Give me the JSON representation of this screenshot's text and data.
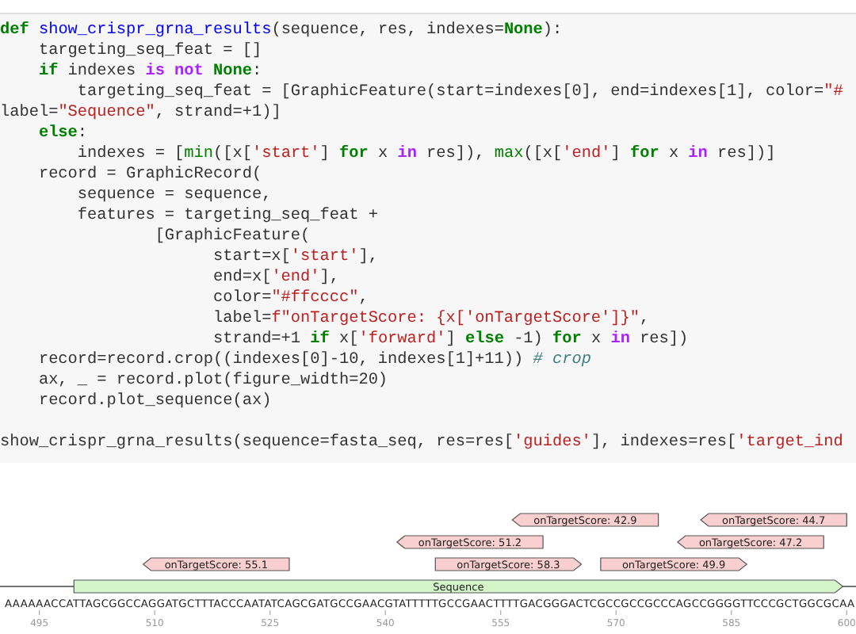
{
  "code_cell": {
    "blocks": [
      {
        "lines": [
          [
            {
              "text": "def ",
              "kind": "keyword"
            },
            {
              "text": "show_crispr_grna_results",
              "kind": "function"
            },
            {
              "text": "(sequence, res, indexes=",
              "kind": "plain"
            },
            {
              "text": "None",
              "kind": "keyword"
            },
            {
              "text": "):",
              "kind": "plain"
            }
          ],
          [
            {
              "text": "    targeting_seq_feat = []",
              "kind": "plain"
            }
          ],
          [
            {
              "text": "    if",
              "kind": "keyword"
            },
            {
              "text": " indexes ",
              "kind": "plain"
            },
            {
              "text": "is not",
              "kind": "operator"
            },
            {
              "text": " None",
              "kind": "keyword"
            },
            {
              "text": ":",
              "kind": "plain"
            }
          ],
          [
            {
              "text": "        targeting_seq_feat = [GraphicFeature(start=indexes[0], end=indexes[1], color=",
              "kind": "plain"
            },
            {
              "text": "\"#",
              "kind": "string"
            }
          ],
          [
            {
              "text": "label=",
              "kind": "plain"
            },
            {
              "text": "\"Sequence\"",
              "kind": "string"
            },
            {
              "text": ", strand=+1)]",
              "kind": "plain"
            }
          ],
          [
            {
              "text": "    else",
              "kind": "keyword"
            },
            {
              "text": ":",
              "kind": "plain"
            }
          ],
          [
            {
              "text": "        indexes = [",
              "kind": "plain"
            },
            {
              "text": "min",
              "kind": "builtin"
            },
            {
              "text": "([x[",
              "kind": "plain"
            },
            {
              "text": "'start'",
              "kind": "string"
            },
            {
              "text": "] ",
              "kind": "plain"
            },
            {
              "text": "for",
              "kind": "keyword"
            },
            {
              "text": " x ",
              "kind": "plain"
            },
            {
              "text": "in",
              "kind": "operator"
            },
            {
              "text": " res]), ",
              "kind": "plain"
            },
            {
              "text": "max",
              "kind": "builtin"
            },
            {
              "text": "([x[",
              "kind": "plain"
            },
            {
              "text": "'end'",
              "kind": "string"
            },
            {
              "text": "] ",
              "kind": "plain"
            },
            {
              "text": "for",
              "kind": "keyword"
            },
            {
              "text": " x ",
              "kind": "plain"
            },
            {
              "text": "in",
              "kind": "operator"
            },
            {
              "text": " res])]",
              "kind": "plain"
            }
          ],
          [
            {
              "text": "    record = GraphicRecord(",
              "kind": "plain"
            }
          ],
          [
            {
              "text": "        sequence = sequence,",
              "kind": "plain"
            }
          ],
          [
            {
              "text": "        features = targeting_seq_feat +",
              "kind": "plain"
            }
          ],
          [
            {
              "text": "                [GraphicFeature(",
              "kind": "plain"
            }
          ],
          [
            {
              "text": "                      start=x[",
              "kind": "plain"
            },
            {
              "text": "'start'",
              "kind": "string"
            },
            {
              "text": "],",
              "kind": "plain"
            }
          ],
          [
            {
              "text": "                      end=x[",
              "kind": "plain"
            },
            {
              "text": "'end'",
              "kind": "string"
            },
            {
              "text": "],",
              "kind": "plain"
            }
          ],
          [
            {
              "text": "                      color=",
              "kind": "plain"
            },
            {
              "text": "\"#ffcccc\"",
              "kind": "string"
            },
            {
              "text": ",",
              "kind": "plain"
            }
          ],
          [
            {
              "text": "                      label=",
              "kind": "plain"
            },
            {
              "text": "f\"onTargetScore: {x['onTargetScore']}\"",
              "kind": "string"
            },
            {
              "text": ",",
              "kind": "plain"
            }
          ],
          [
            {
              "text": "                      strand=+1 ",
              "kind": "plain"
            },
            {
              "text": "if",
              "kind": "keyword"
            },
            {
              "text": " x[",
              "kind": "plain"
            },
            {
              "text": "'forward'",
              "kind": "string"
            },
            {
              "text": "] ",
              "kind": "plain"
            },
            {
              "text": "else",
              "kind": "keyword"
            },
            {
              "text": " -1) ",
              "kind": "plain"
            },
            {
              "text": "for",
              "kind": "keyword"
            },
            {
              "text": " x ",
              "kind": "plain"
            },
            {
              "text": "in",
              "kind": "operator"
            },
            {
              "text": " res])",
              "kind": "plain"
            }
          ],
          [
            {
              "text": "    record=record.crop((indexes[0]-10, indexes[1]+11)) ",
              "kind": "plain"
            },
            {
              "text": "# crop",
              "kind": "comment"
            }
          ],
          [
            {
              "text": "    ax, _ = record.plot(figure_width=20)",
              "kind": "plain"
            }
          ],
          [
            {
              "text": "    record.plot_sequence(ax)",
              "kind": "plain"
            }
          ]
        ]
      },
      {
        "lines": [
          [
            {
              "text": "show_crispr_grna_results(sequence=fasta_seq, res=res[",
              "kind": "plain"
            },
            {
              "text": "'guides'",
              "kind": "string"
            },
            {
              "text": "], indexes=res[",
              "kind": "plain"
            },
            {
              "text": "'target_ind",
              "kind": "string"
            }
          ]
        ]
      }
    ]
  },
  "plot": {
    "lanes": [
      [
        {
          "label": "onTargetScore: 42.9",
          "kind": "reverse"
        },
        {
          "label": "onTargetScore: 44.7",
          "kind": "reverse"
        }
      ],
      [
        {
          "label": "onTargetScore: 51.2",
          "kind": "reverse"
        },
        {
          "label": "onTargetScore: 47.2",
          "kind": "reverse"
        }
      ],
      [
        {
          "label": "onTargetScore: 55.1",
          "kind": "reverse"
        },
        {
          "label": "onTargetScore: 58.3",
          "kind": "forward"
        },
        {
          "label": "onTargetScore: 49.9",
          "kind": "forward"
        }
      ]
    ],
    "sequence": "AAAAAACCATTAGCGGCCAGGATGCTTTACCCAATATCAGCGATGCCGAACGTATTTTTGCCGAACTTTTGACGGGACTCGCCGCCGCCCAGCCGGGGTTCCCGCTGGCGCAA",
    "sequence_feature": {
      "label": "Sequence",
      "kind": "forward"
    },
    "ticks": [
      "495",
      "510",
      "525",
      "540",
      "555",
      "570",
      "585",
      "600"
    ]
  }
}
